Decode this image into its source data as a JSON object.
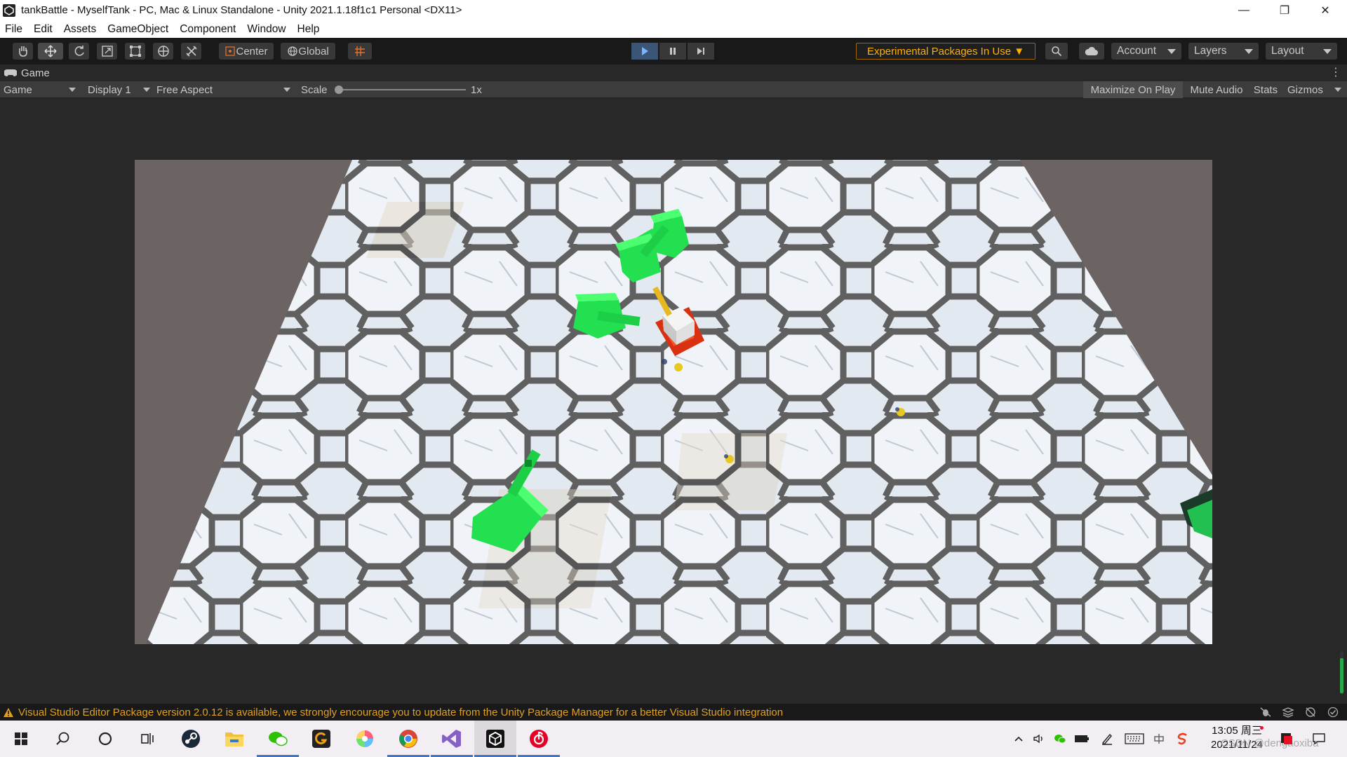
{
  "window": {
    "title": "tankBattle - MyselfTank - PC, Mac & Linux Standalone - Unity 2021.1.18f1c1 Personal <DX11>",
    "controls": [
      "—",
      "❐",
      "✕"
    ]
  },
  "menu": [
    "File",
    "Edit",
    "Assets",
    "GameObject",
    "Component",
    "Window",
    "Help"
  ],
  "toolbar": {
    "tools": [
      "hand-tool",
      "move-tool",
      "rotate-tool",
      "scale-tool",
      "rect-tool",
      "transform-tool",
      "custom-tool"
    ],
    "pivot_label": "Center",
    "space_label": "Global",
    "experimental_label": "Experimental Packages In Use ▼",
    "account_label": "Account",
    "layers_label": "Layers",
    "layout_label": "Layout"
  },
  "game_tab": {
    "label": "Game"
  },
  "game_bar": {
    "mode": "Game",
    "display": "Display 1",
    "aspect": "Free Aspect",
    "scale_label": "Scale",
    "scale_value": "1x",
    "maximize": "Maximize On Play",
    "mute": "Mute Audio",
    "stats": "Stats",
    "gizmos": "Gizmos"
  },
  "status": {
    "message": "Visual Studio Editor Package version 2.0.12 is available, we strongly encourage you to update from the Unity Package Manager for a better Visual Studio integration"
  },
  "taskbar": {
    "clock_time": "13:05 周三",
    "clock_date": "2021/11/24",
    "watermark": "CSDN @dengaoxiba"
  },
  "colors": {
    "accent_play": "#3a5576",
    "warning": "#e0a020",
    "enemy_tank": "#22e050",
    "player_base": "#d83010"
  }
}
